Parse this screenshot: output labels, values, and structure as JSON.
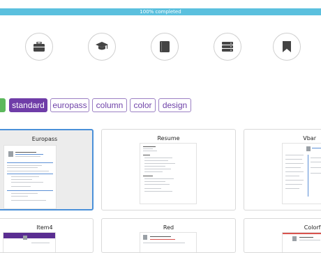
{
  "progress": {
    "label": "100% completed",
    "percent": 100,
    "color": "#5bc0de"
  },
  "steps": [
    {
      "icon": "briefcase-icon"
    },
    {
      "icon": "graduation-cap-icon"
    },
    {
      "icon": "book-icon"
    },
    {
      "icon": "server-icon"
    },
    {
      "icon": "bookmark-icon"
    }
  ],
  "filters": {
    "items": [
      "standard",
      "europass",
      "column",
      "color",
      "design"
    ],
    "active": "standard",
    "accent": "#6f3da8"
  },
  "templates": [
    {
      "name": "Europass",
      "selected": true
    },
    {
      "name": "Resume",
      "selected": false
    },
    {
      "name": "Vbar",
      "selected": false
    },
    {
      "name": "Item4",
      "selected": false
    },
    {
      "name": "Red",
      "selected": false
    },
    {
      "name": "Colorfull",
      "selected": false
    }
  ]
}
